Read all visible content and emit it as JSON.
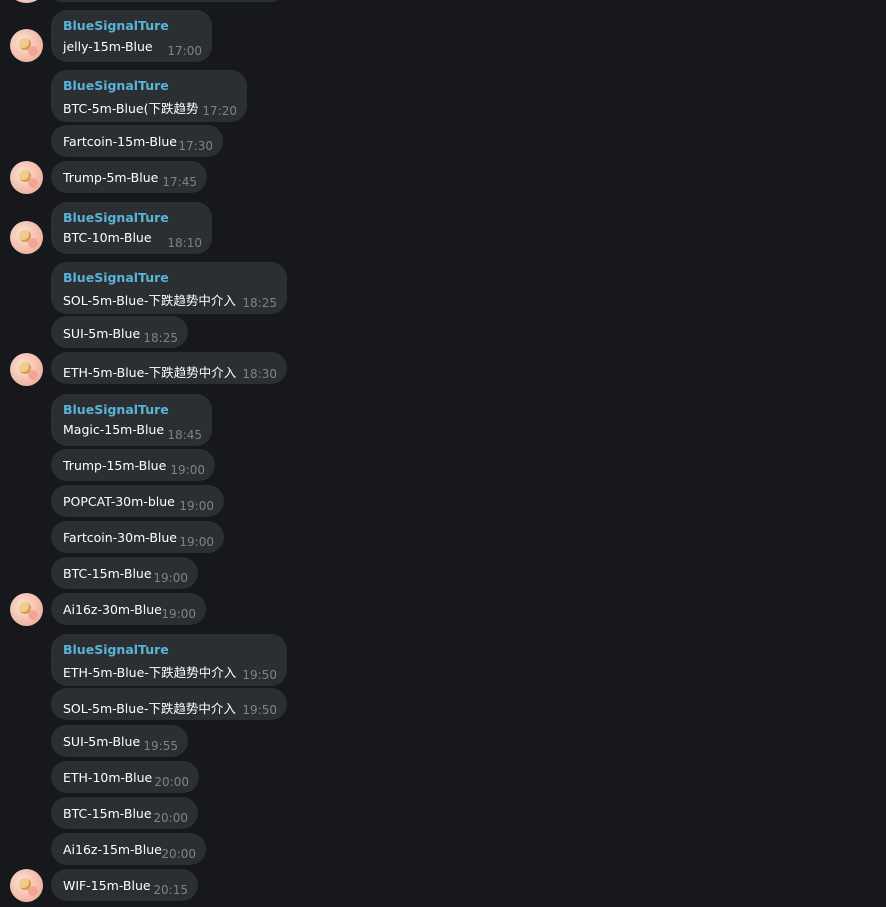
{
  "messages": [
    {
      "sender": "BlueSignalTure",
      "text": "jelly-15m-Blue",
      "time": "17:00"
    },
    {
      "sender": "BlueSignalTure",
      "text": "BTC-5m-Blue(下跌趋势",
      "time": "17:20"
    },
    {
      "text": "Fartcoin-15m-Blue",
      "time": "17:30"
    },
    {
      "text": "Trump-5m-Blue",
      "time": "17:45"
    },
    {
      "sender": "BlueSignalTure",
      "text": "BTC-10m-Blue",
      "time": "18:10"
    },
    {
      "sender": "BlueSignalTure",
      "text": "SOL-5m-Blue-下跌趋势中介入",
      "time": "18:25"
    },
    {
      "text": "SUI-5m-Blue",
      "time": "18:25"
    },
    {
      "text": "ETH-5m-Blue-下跌趋势中介入",
      "time": "18:30"
    },
    {
      "sender": "BlueSignalTure",
      "text": "Magic-15m-Blue",
      "time": "18:45"
    },
    {
      "text": "Trump-15m-Blue",
      "time": "19:00"
    },
    {
      "text": "POPCAT-30m-blue",
      "time": "19:00"
    },
    {
      "text": "Fartcoin-30m-Blue",
      "time": "19:00"
    },
    {
      "text": "BTC-15m-Blue",
      "time": "19:00"
    },
    {
      "text": "Ai16z-30m-Blue",
      "time": "19:00"
    },
    {
      "sender": "BlueSignalTure",
      "text": "ETH-5m-Blue-下跌趋势中介入",
      "time": "19:50"
    },
    {
      "text": "SOL-5m-Blue-下跌趋势中介入",
      "time": "19:50"
    },
    {
      "text": "SUI-5m-Blue",
      "time": "19:55"
    },
    {
      "text": "ETH-10m-Blue",
      "time": "20:00"
    },
    {
      "text": "BTC-15m-Blue",
      "time": "20:00"
    },
    {
      "text": "Ai16z-15m-Blue",
      "time": "20:00"
    },
    {
      "text": "WIF-15m-Blue",
      "time": "20:15"
    }
  ]
}
